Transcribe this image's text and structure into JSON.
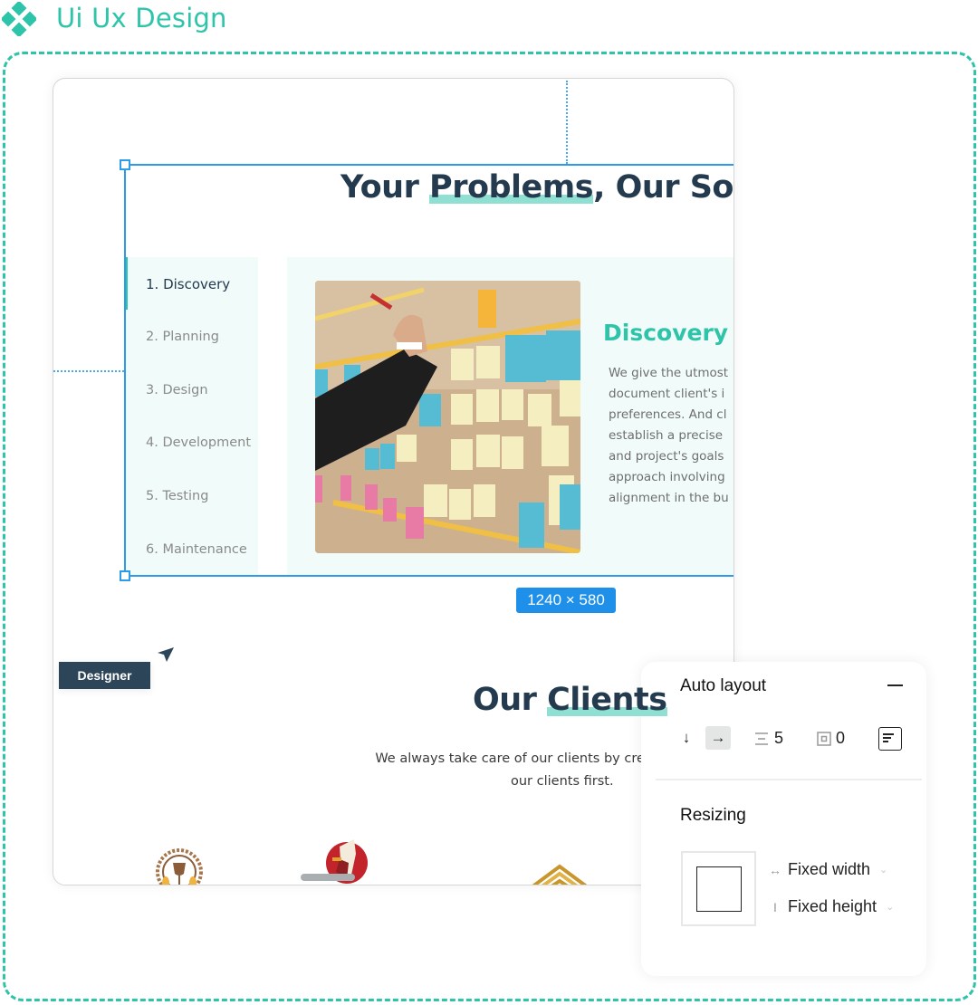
{
  "header": {
    "title": "Ui Ux Design",
    "logo_icon": "diamond-grid-icon",
    "accent_color": "#2ec4a9"
  },
  "canvas": {
    "section": {
      "title_before": "Your ",
      "title_highlight": "Problems",
      "title_after": ", Our Solut",
      "tabs": [
        {
          "label": "1. Discovery",
          "active": true
        },
        {
          "label": "2. Planning",
          "active": false
        },
        {
          "label": "3. Design",
          "active": false
        },
        {
          "label": "4. Development",
          "active": false
        },
        {
          "label": "5. Testing",
          "active": false
        },
        {
          "label": "6. Maintenance",
          "active": false
        }
      ],
      "content_title": "Discovery",
      "content_lines": [
        "We give the utmost",
        "document client's i",
        "preferences. And cl",
        "establish a precise",
        "and project's goals",
        "approach involving",
        "alignment in the bu"
      ],
      "image_alt": "sticky-notes-board-photo"
    },
    "selection_dimensions": "1240 × 580",
    "selection_color": "#2d9be8",
    "clients": {
      "title_before": "Our ",
      "title_highlight": "Clients",
      "line1": "We always take care of our clients by creatin",
      "line2": "our clients first.",
      "logos": [
        "winery-logo",
        "rooster-logo",
        "gold-roof-logo"
      ]
    }
  },
  "cursor": {
    "label": "Designer",
    "color": "#2d4558"
  },
  "properties_panel": {
    "auto_layout": {
      "title": "Auto layout",
      "remove_icon": "minus-icon",
      "direction_options": [
        "arrow-down-icon",
        "arrow-right-icon"
      ],
      "selected_direction": "horizontal",
      "spacing_value": "5",
      "padding_value": "0",
      "alignment_icon": "align-top-left-icon"
    },
    "resizing": {
      "title": "Resizing",
      "width_mode": "Fixed width",
      "height_mode": "Fixed height"
    }
  }
}
